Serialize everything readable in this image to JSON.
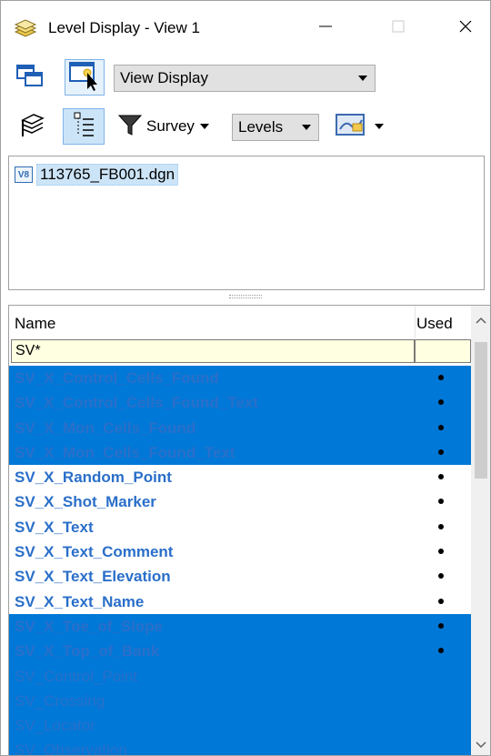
{
  "window": {
    "title": "Level Display - View 1",
    "icons": {
      "app": "levels-stack-icon",
      "minimize": "minimize-icon",
      "maximize": "maximize-icon",
      "close": "close-icon"
    }
  },
  "toolbar1": {
    "view_select": "View Display",
    "icons": [
      "view-windows-icon",
      "select-view-icon"
    ]
  },
  "toolbar2": {
    "filter_label": "Survey",
    "levels_select": "Levels",
    "icons": [
      "level-manager-icon",
      "list-view-icon",
      "filter-icon",
      "display-mode-icon"
    ]
  },
  "file_tree": {
    "badge": "V8",
    "file": "113765_FB001.dgn"
  },
  "level_list": {
    "columns": {
      "name": "Name",
      "used": "Used"
    },
    "filter_value": "SV*",
    "rows": [
      {
        "name": "SV_X_Control_Cells_Found",
        "used": true,
        "selected": true,
        "bold": true
      },
      {
        "name": "SV_X_Control_Cells_Found_Text",
        "used": true,
        "selected": true,
        "bold": true
      },
      {
        "name": "SV_X_Mon_Cells_Found",
        "used": true,
        "selected": true,
        "bold": true
      },
      {
        "name": "SV_X_Mon_Cells_Found_Text",
        "used": true,
        "selected": true,
        "bold": true
      },
      {
        "name": "SV_X_Random_Point",
        "used": true,
        "selected": false,
        "bold": true
      },
      {
        "name": "SV_X_Shot_Marker",
        "used": true,
        "selected": false,
        "bold": true
      },
      {
        "name": "SV_X_Text",
        "used": true,
        "selected": false,
        "bold": true
      },
      {
        "name": "SV_X_Text_Comment",
        "used": true,
        "selected": false,
        "bold": true
      },
      {
        "name": "SV_X_Text_Elevation",
        "used": true,
        "selected": false,
        "bold": true
      },
      {
        "name": "SV_X_Text_Name",
        "used": true,
        "selected": false,
        "bold": true
      },
      {
        "name": "SV_X_Toe_of_Slope",
        "used": true,
        "selected": true,
        "bold": true
      },
      {
        "name": "SV_X_Top_of_Bank",
        "used": true,
        "selected": true,
        "bold": true
      },
      {
        "name": "SV_Control_Point",
        "used": false,
        "selected": true,
        "bold": false
      },
      {
        "name": "SV_Crossing",
        "used": false,
        "selected": true,
        "bold": false
      },
      {
        "name": "SV_Locator",
        "used": false,
        "selected": true,
        "bold": false
      },
      {
        "name": "SV_Observation",
        "used": false,
        "selected": true,
        "bold": false
      }
    ]
  },
  "colors": {
    "selection": "#0078d7",
    "level_text": "#2a6fc9",
    "filter_bg": "#ffffe1"
  }
}
